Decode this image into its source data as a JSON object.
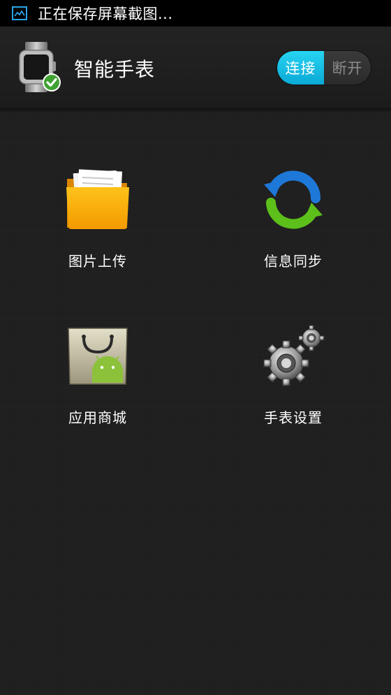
{
  "status_bar": {
    "icon": "screenshot-icon",
    "text": "正在保存屏幕截图..."
  },
  "header": {
    "title": "智能手表",
    "icon": "smartwatch-connected-icon",
    "toggle": {
      "on_label": "连接",
      "off_label": "断开",
      "state": "连接",
      "accent": "#1ec3e8"
    }
  },
  "tiles": [
    {
      "label": "图片上传",
      "icon": "folder-icon"
    },
    {
      "label": "信息同步",
      "icon": "sync-icon"
    },
    {
      "label": "应用商城",
      "icon": "app-store-bag-icon"
    },
    {
      "label": "手表设置",
      "icon": "gears-icon"
    }
  ]
}
